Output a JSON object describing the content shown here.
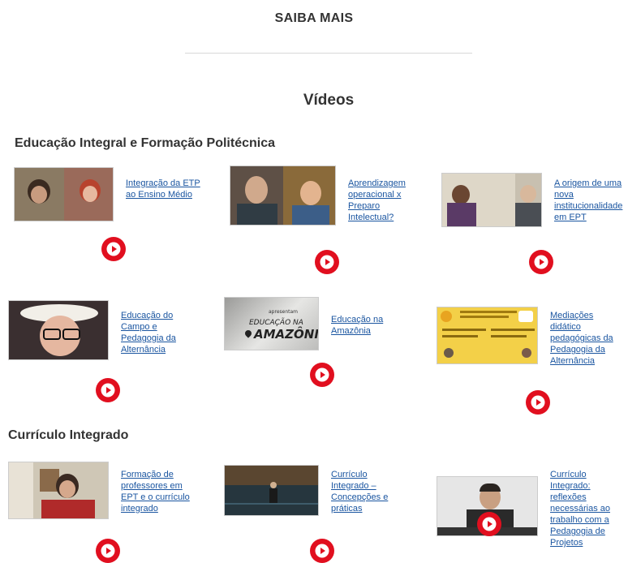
{
  "header": {
    "title": "SAIBA MAIS"
  },
  "videos_title": "Vídeos",
  "sections": [
    {
      "title": "Educação Integral e Formação Politécnica",
      "videos": [
        {
          "label": "Integração da ETP ao Ensino Médio"
        },
        {
          "label": "Aprendizagem operacional x Preparo Intelectual?"
        },
        {
          "label": "A origem de uma nova institucionalidade em EPT"
        },
        {
          "label": "Educação do Campo e Pedagogia da Alternância"
        },
        {
          "label": "Educação na Amazônia",
          "thumb_text_small": "apresentam",
          "thumb_text_1": "EDUCAÇÃO NA",
          "thumb_text_2": "AMAZÔNIA"
        },
        {
          "label": "Mediações didático pedagógicas da Pedagogia da Alternância"
        }
      ]
    },
    {
      "title": "Currículo Integrado",
      "videos": [
        {
          "label": "Formação de professores em EPT e o currículo integrado"
        },
        {
          "label": "Currículo Integrado – Concepções e práticas"
        },
        {
          "label": "Currículo Integrado: reflexões necessárias ao trabalho com a Pedagogia de Projetos"
        }
      ]
    }
  ],
  "colors": {
    "play": "#e10f1f",
    "link": "#1a55a0"
  },
  "icons": {
    "play": "play-icon"
  }
}
